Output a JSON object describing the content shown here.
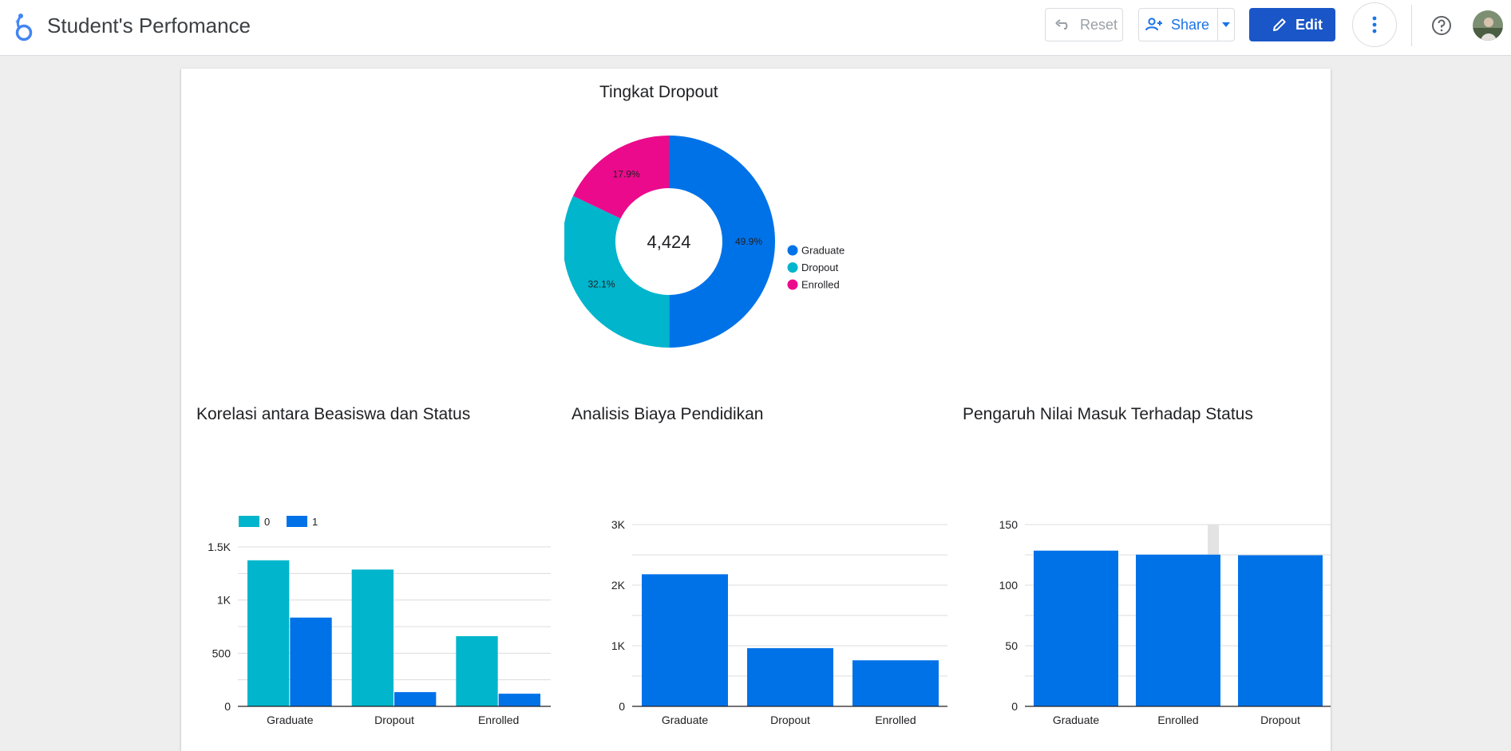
{
  "header": {
    "app_title": "Student's Perfomance",
    "reset_label": "Reset",
    "share_label": "Share",
    "edit_label": "Edit"
  },
  "icons": {
    "logo": "looker-studio-logo-icon",
    "reset": "undo-icon",
    "share": "person-add-icon",
    "share_menu": "caret-down-icon",
    "edit": "pencil-icon",
    "more": "more-vert-icon",
    "help": "help-circle-icon",
    "avatar": "user-avatar-icon"
  },
  "colors": {
    "graduate": "#0072e8",
    "dropout": "#00b5cc",
    "enrolled": "#eb0a8c",
    "accent": "#1a73e8",
    "highlight_band": "#e3e3e3"
  },
  "donut": {
    "title": "Tingkat Dropout",
    "center_value": "4,424"
  },
  "bar1": {
    "title": "Korelasi antara Beasiswa dan Status"
  },
  "bar2": {
    "title": "Analisis Biaya Pendidikan"
  },
  "bar3": {
    "title": "Pengaruh Nilai Masuk Terhadap Status"
  },
  "chart_data": [
    {
      "type": "pie",
      "title": "Tingkat Dropout",
      "donut": true,
      "center_label": "4,424",
      "slices": [
        {
          "label": "Graduate",
          "value": 49.9,
          "display": "49.9%",
          "color": "#0072e8"
        },
        {
          "label": "Dropout",
          "value": 32.1,
          "display": "32.1%",
          "color": "#00b5cc"
        },
        {
          "label": "Enrolled",
          "value": 17.9,
          "display": "17.9%",
          "color": "#eb0a8c"
        }
      ],
      "legend_position": "right"
    },
    {
      "type": "bar",
      "title": "Korelasi antara Beasiswa dan Status",
      "categories": [
        "Graduate",
        "Dropout",
        "Enrolled"
      ],
      "series": [
        {
          "name": "0",
          "values": [
            1374,
            1287,
            660
          ],
          "color": "#00b5cc"
        },
        {
          "name": "1",
          "values": [
            835,
            134,
            119
          ],
          "color": "#0072e8"
        }
      ],
      "yticks": [
        0,
        500,
        1000,
        1500
      ],
      "ytick_labels": [
        "0",
        "500",
        "1K",
        "1.5K"
      ],
      "ylim": [
        0,
        1500
      ],
      "legend_position": "top-left",
      "grid": true
    },
    {
      "type": "bar",
      "title": "Analisis Biaya Pendidikan",
      "categories": [
        "Graduate",
        "Dropout",
        "Enrolled"
      ],
      "series": [
        {
          "values": [
            2180,
            960,
            760
          ],
          "color": "#0072e8"
        }
      ],
      "yticks": [
        0,
        1000,
        2000,
        3000
      ],
      "ytick_labels": [
        "0",
        "1K",
        "2K",
        "3K"
      ],
      "ylim": [
        0,
        3000
      ],
      "grid": true
    },
    {
      "type": "bar",
      "title": "Pengaruh Nilai Masuk Terhadap Status",
      "categories": [
        "Graduate",
        "Enrolled",
        "Dropout"
      ],
      "series": [
        {
          "values": [
            128.5,
            125.2,
            124.7
          ],
          "color": "#0072e8"
        }
      ],
      "yticks": [
        0,
        50,
        100,
        150
      ],
      "ytick_labels": [
        "0",
        "50",
        "100",
        "150"
      ],
      "ylim": [
        0,
        150
      ],
      "grid": true
    }
  ]
}
